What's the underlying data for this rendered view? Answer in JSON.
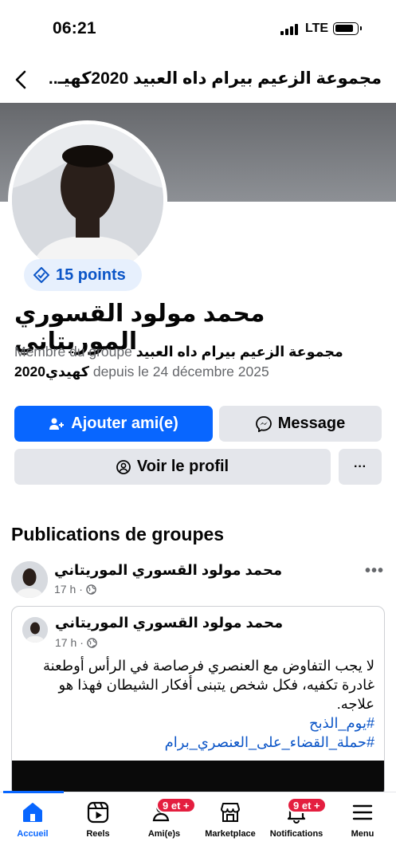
{
  "status_bar": {
    "time": "06:21",
    "network": "LTE"
  },
  "header": {
    "title": "مجموعة الزعيم بيرام داه العبيد 2020كهيـ.."
  },
  "profile": {
    "points": "15 points",
    "name": "محمد مولود القسوري الموريتاني",
    "member_prefix": "Membre du groupe",
    "group_name_line1": "مجموعة الزعيم بيرام داه العبيد",
    "group_name_line2": "2020كهيدي",
    "member_since": "depuis le 24 décembre 2025"
  },
  "actions": {
    "add_friend": "Ajouter ami(e)",
    "message": "Message",
    "view_profile": "Voir le profil",
    "more": "···"
  },
  "publications": {
    "section_title": "Publications de groupes",
    "post": {
      "author": "محمد مولود القسوري الموريتاني",
      "time": "17 h",
      "more": "•••",
      "shared": {
        "author": "محمد مولود القسوري الموريتاني",
        "time": "17 h",
        "text": "لا يجب التفاوض مع العنصري فرصاصة في الرأس أوطعنة غادرة تكفيه، فكل شخص يتبنى أفكار الشيطان فهذا هو علاجه.",
        "hashtag1": "#يوم_الذبح",
        "hashtag2": "#حملة_القضاء_على_العنصري_برام"
      }
    }
  },
  "tabs": [
    {
      "label": "Accueil",
      "icon": "home-icon",
      "active": true
    },
    {
      "label": "Reels",
      "icon": "reels-icon"
    },
    {
      "label": "Ami(e)s",
      "icon": "friends-icon",
      "badge": "9 et +"
    },
    {
      "label": "Marketplace",
      "icon": "marketplace-icon"
    },
    {
      "label": "Notifications",
      "icon": "bell-icon",
      "badge": "9 et +"
    },
    {
      "label": "Menu",
      "icon": "menu-icon"
    }
  ],
  "colors": {
    "accent": "#0866ff",
    "badge": "#e41e3f",
    "secondary_button": "#e4e6eb"
  }
}
